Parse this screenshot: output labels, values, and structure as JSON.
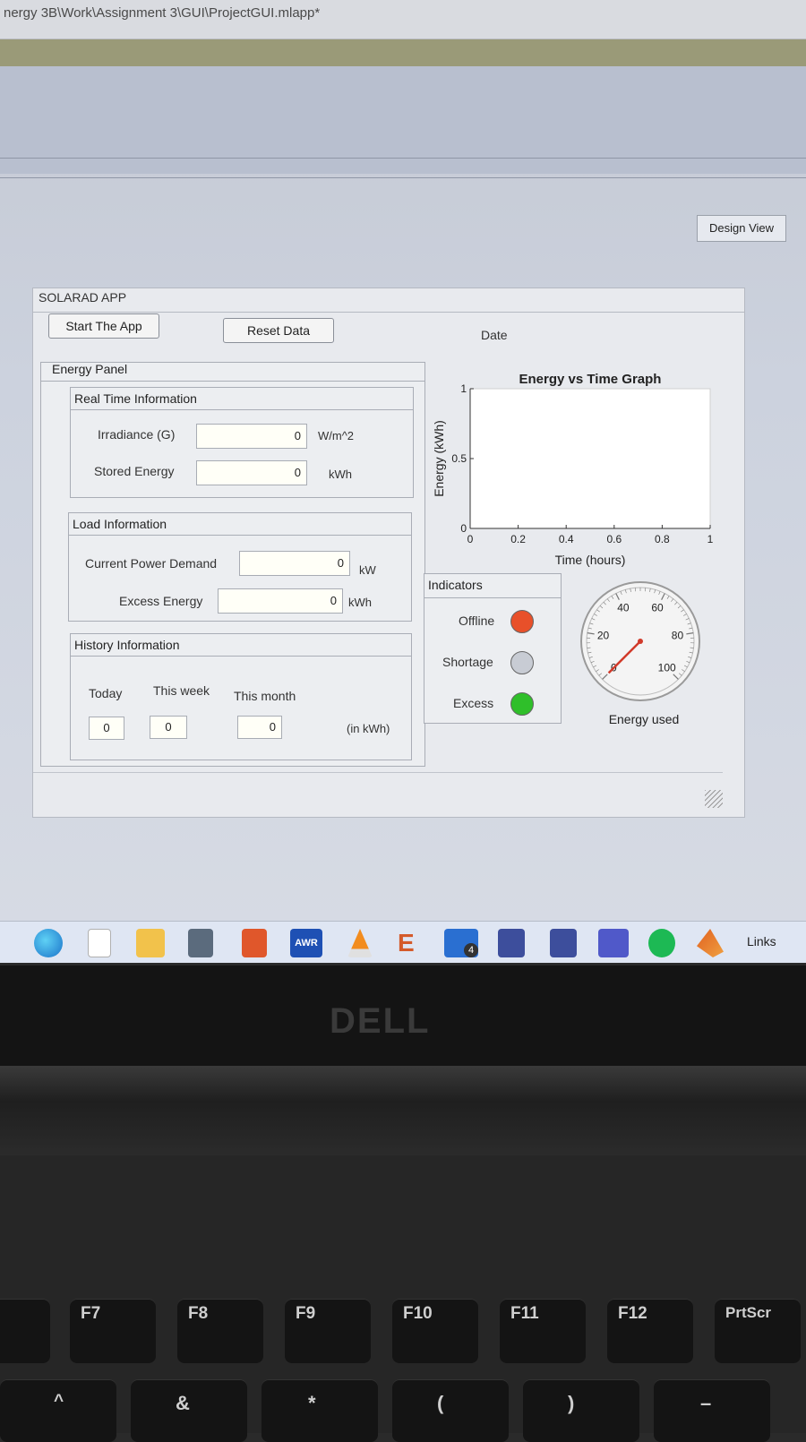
{
  "window": {
    "title": "nergy 3B\\Work\\Assignment 3\\GUI\\ProjectGUI.mlapp*",
    "design_view_label": "Design View"
  },
  "app": {
    "title": "SOLARAD APP",
    "start_button": "Start The App",
    "reset_button": "Reset Data",
    "date_label": "Date",
    "energy_panel": {
      "title": "Energy Panel",
      "real_time": {
        "title": "Real Time Information",
        "irradiance_label": "Irradiance (G)",
        "irradiance_value": "0",
        "irradiance_unit": "W/m^2",
        "stored_label": "Stored Energy",
        "stored_value": "0",
        "stored_unit": "kWh"
      },
      "load": {
        "title": "Load Information",
        "demand_label": "Current Power Demand",
        "demand_value": "0",
        "demand_unit": "kW",
        "excess_label": "Excess Energy",
        "excess_value": "0",
        "excess_unit": "kWh"
      },
      "history": {
        "title": "History Information",
        "today_label": "Today",
        "week_label": "This week",
        "month_label": "This month",
        "today_value": "0",
        "week_value": "0",
        "month_value": "0",
        "unit": "(in kWh)"
      }
    },
    "indicators": {
      "title": "Indicators",
      "offline_label": "Offline",
      "shortage_label": "Shortage",
      "excess_label": "Excess",
      "offline_color": "#e8502a",
      "shortage_color": "#c8ccd4",
      "excess_color": "#2fbf2a"
    },
    "gauge": {
      "label": "Energy used",
      "ticks": [
        "0",
        "20",
        "40",
        "60",
        "80",
        "100"
      ],
      "value": 0
    }
  },
  "chart_data": {
    "type": "line",
    "title": "Energy vs Time  Graph",
    "xlabel": "Time (hours)",
    "ylabel": "Energy (kWh)",
    "xlim": [
      0,
      1
    ],
    "ylim": [
      0,
      1
    ],
    "x_ticks": [
      "0",
      "0.2",
      "0.4",
      "0.6",
      "0.8",
      "1"
    ],
    "y_ticks": [
      "0",
      "0.5",
      "1"
    ],
    "series": []
  },
  "taskbar": {
    "links_label": "Links",
    "mail_badge": "4",
    "icons": [
      "edge-icon",
      "notepad-icon",
      "file-explorer-icon",
      "calculator-icon",
      "office-icon",
      "awr-icon",
      "vlc-icon",
      "app-e-icon",
      "mail-icon",
      "app-icon-1",
      "app-icon-2",
      "teams-icon",
      "spotify-icon",
      "matlab-icon"
    ]
  },
  "laptop": {
    "brand": "DELL",
    "fkeys": [
      "F7",
      "F8",
      "F9",
      "F10",
      "F11",
      "F12",
      "PrtScr"
    ],
    "bottom_keys": [
      "^",
      "&",
      "*",
      "(",
      ")",
      "–"
    ]
  }
}
